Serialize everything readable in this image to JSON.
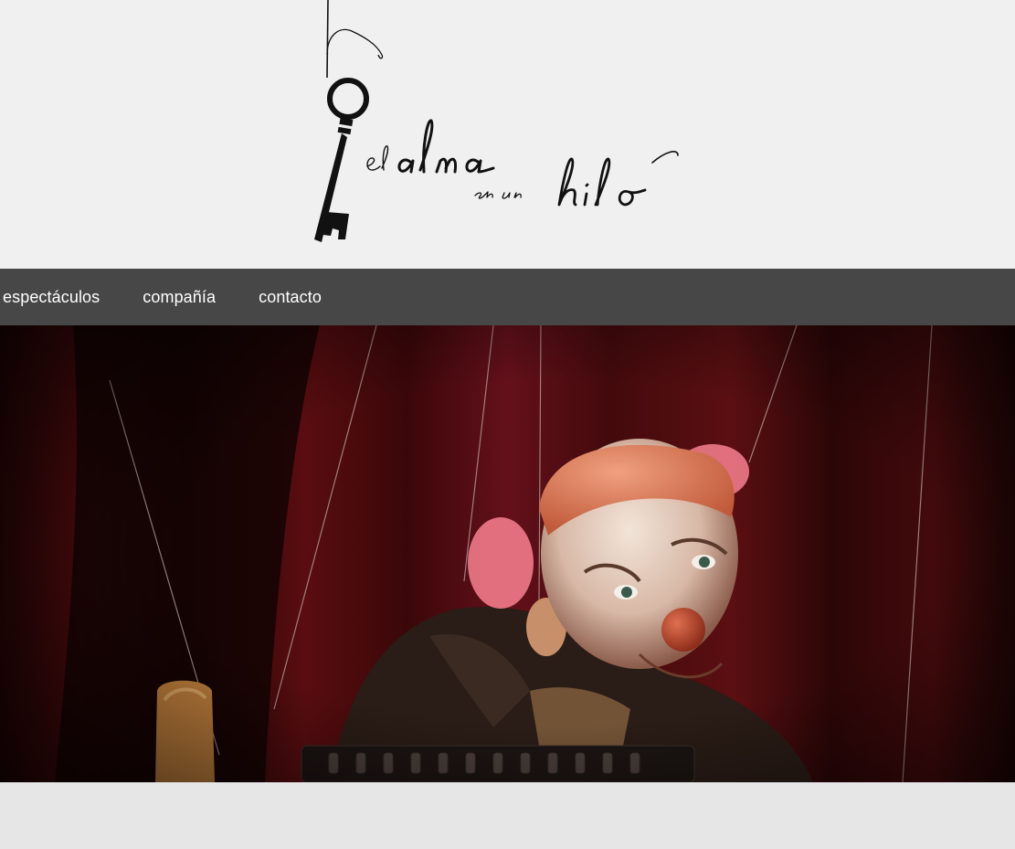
{
  "brand": {
    "logo_text": "el alma en un hilo",
    "logo_icon": "hanging-key-icon"
  },
  "nav": {
    "items": [
      {
        "label": "espectáculos"
      },
      {
        "label": "compañía"
      },
      {
        "label": "contacto"
      }
    ]
  },
  "hero": {
    "image": "clown-marionette-photo"
  },
  "colors": {
    "header_bg": "#f0f0f0",
    "nav_bg": "#474747",
    "nav_text": "#ffffff",
    "page_bg": "#e6e6e6"
  }
}
